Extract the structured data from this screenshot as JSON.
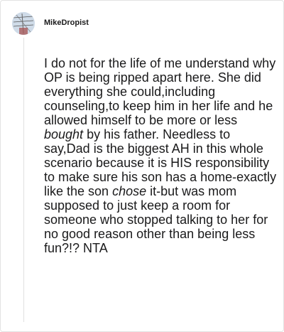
{
  "comment": {
    "username": "MikeDropist",
    "avatar": "user-avatar",
    "segments": [
      {
        "text": "I do not for the life of me understand why OP is being ripped apart here. She did everything she could,including counseling,to keep him in her life and he allowed himself to be more or less ",
        "italic": false
      },
      {
        "text": "bought",
        "italic": true
      },
      {
        "text": " by his father. Needless to say,Dad is the biggest AH in this whole scenario because it is HIS responsibility to make sure his son has a home-exactly like the son ",
        "italic": false
      },
      {
        "text": "chose",
        "italic": true
      },
      {
        "text": " it-but was mom supposed to just keep a room for someone who stopped talking to her for no good reason other than being less fun?!? NTA",
        "italic": false
      }
    ]
  }
}
